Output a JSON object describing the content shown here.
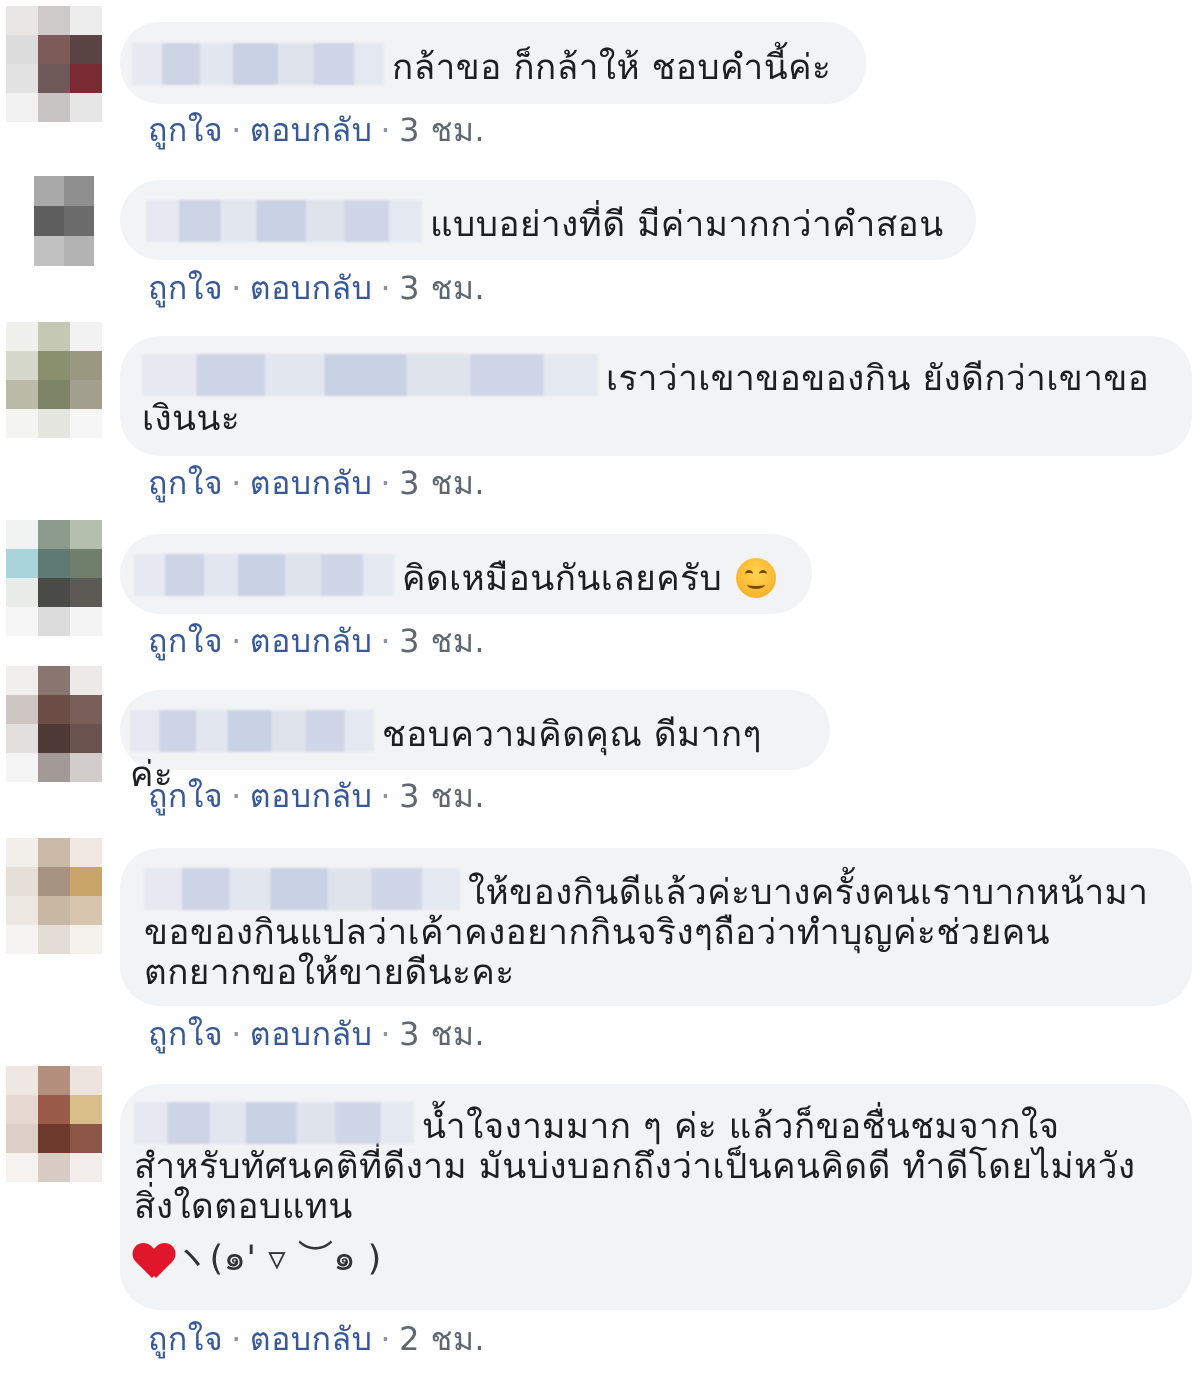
{
  "actions": {
    "like": "ถูกใจ",
    "reply": "ตอบกลับ",
    "sep": "·"
  },
  "comments": [
    {
      "text": "กล้าขอ ก็กล้าให้ ชอบคำนี้ค่ะ",
      "time": "3 ชม."
    },
    {
      "text": "แบบอย่างที่ดี มีค่ามากกว่าคำสอน",
      "time": "3 ชม."
    },
    {
      "text": "เราว่าเขาขอของกิน ยังดีกว่าเขาขอเงินนะ",
      "time": "3 ชม."
    },
    {
      "text": "คิดเหมือนกันเลยครับ",
      "emoji": "smiling-face-icon",
      "time": "3 ชม."
    },
    {
      "text": "ชอบความคิดคุณ ดีมากๆค่ะ",
      "time": "3 ชม."
    },
    {
      "text": "ให้ของกินดีแล้วค่ะบางครั้งคนเราบากหน้ามาขอของกินแปลว่าเค้าคงอยากกินจริงๆถือว่าทำบุญค่ะช่วยคนตกยากขอให้ขายดีนะคะ",
      "time": "3 ชม."
    },
    {
      "text": "น้ำใจงามมาก ๆ ค่ะ แล้วก็ขอชื่นชมจากใจสำหรับทัศนคติที่ดีงาม มันบ่งบอกถึงว่าเป็นคนคิดดี ทำดีโดยไม่หวังสิ่งใดตอบแทน",
      "emoji_line": "ヽ(๑' ▿ ︶๑ )",
      "emoji": "red-heart-icon",
      "time": "2 ชม."
    }
  ]
}
